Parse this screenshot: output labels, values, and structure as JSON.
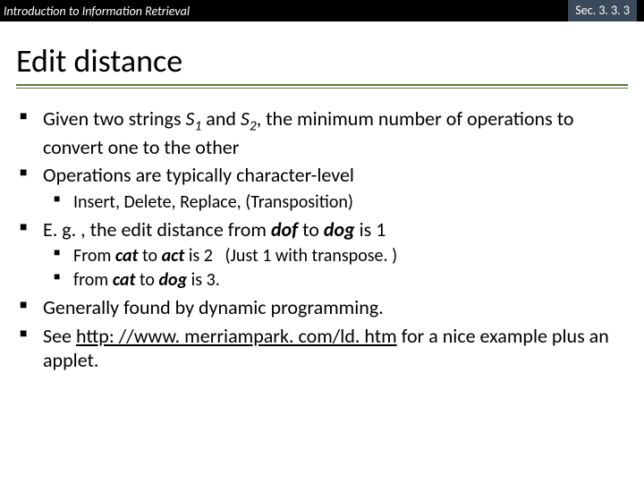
{
  "header": {
    "left": "Introduction to Information Retrieval",
    "right": "Sec. 3. 3. 3"
  },
  "title": "Edit distance",
  "bullets": {
    "b1a": "Given two strings ",
    "b1b": "S",
    "b1c": "1",
    "b1d": " and ",
    "b1e": "S",
    "b1f": "2",
    "b1g": ", the minimum number of operations to convert one to the other",
    "b2": "Operations are typically character-level",
    "b2_1": "Insert, Delete, Replace, (Transposition)",
    "b3a": "E. g. , the edit distance from ",
    "b3b": "dof",
    "b3c": " to ",
    "b3d": "dog",
    "b3e": " is 1",
    "b3_1a": "From ",
    "b3_1b": "cat",
    "b3_1c": " to ",
    "b3_1d": "act",
    "b3_1e": " is 2",
    "b3_1f": "(Just 1 with transpose. )",
    "b3_2a": "from ",
    "b3_2b": "cat",
    "b3_2c": " to ",
    "b3_2d": "dog",
    "b3_2e": " is 3.",
    "b4": "Generally found by dynamic programming.",
    "b5a": "See ",
    "b5b": "http: //www. merriampark. com/ld. htm",
    "b5c": " for a nice example plus an applet."
  }
}
